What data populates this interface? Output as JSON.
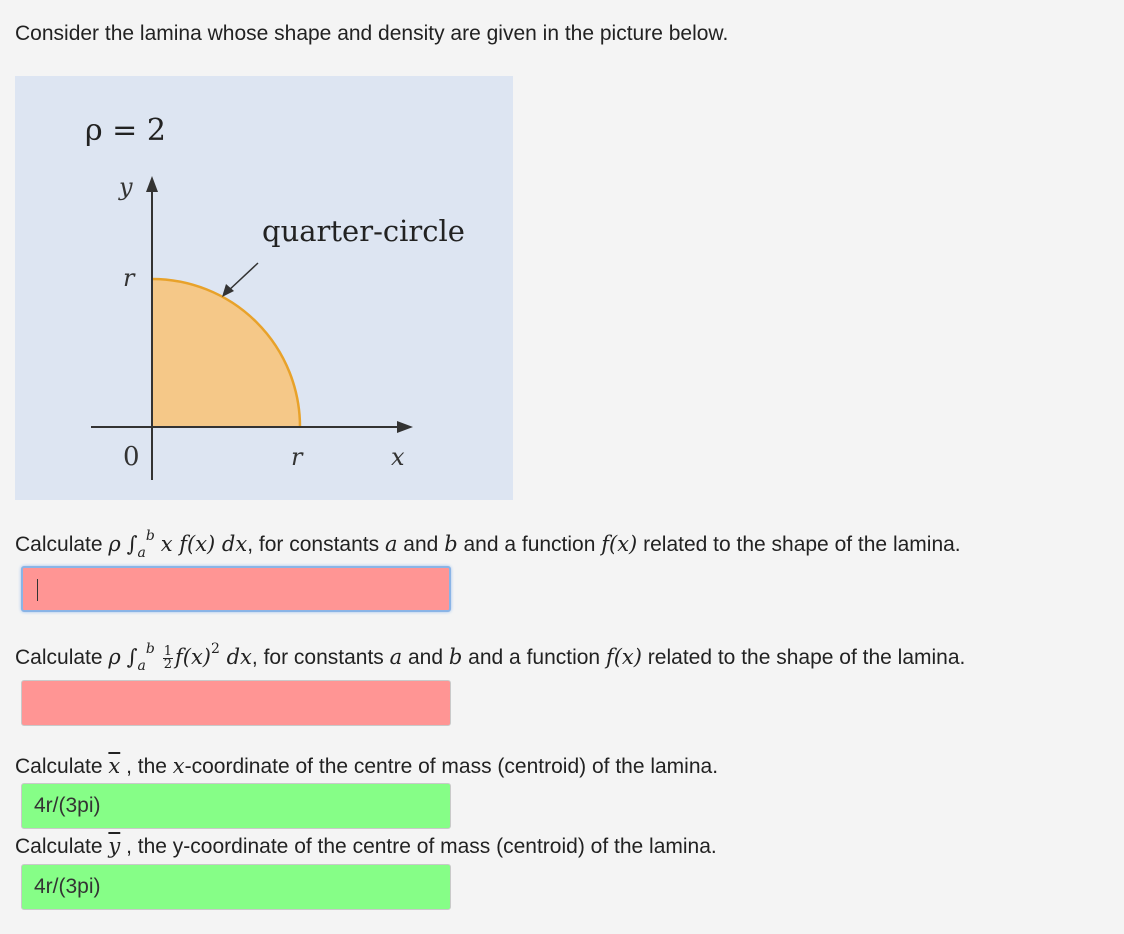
{
  "intro": "Consider the lamina whose shape and density are given in the picture below.",
  "figure": {
    "density_label": "ρ = 2",
    "y_axis": "y",
    "x_axis": "x",
    "r_vertical": "r",
    "r_horizontal": "r",
    "origin": "0",
    "shape_label": "quarter-circle",
    "colors": {
      "background": "#dde5f2",
      "fill": "#f5c888",
      "edge": "#e8a22a"
    }
  },
  "q1": {
    "prefix": "Calculate ",
    "rho": "ρ",
    "integral": "∫",
    "lower": "a",
    "upper": "b",
    "integrand": "x f(x) dx",
    "mid": ", for constants ",
    "a": "a",
    "and": " and ",
    "b": "b",
    "func_text": " and a function ",
    "fx": "f(x)",
    "suffix": " related to the shape of the lamina.",
    "value": "",
    "status": "incorrect"
  },
  "q2": {
    "prefix": "Calculate ",
    "rho": "ρ",
    "integral": "∫",
    "lower": "a",
    "upper": "b",
    "frac_num": "1",
    "frac_den": "2",
    "integrand": "f(x)",
    "power": "2",
    "dx": " dx",
    "mid": ", for constants ",
    "a": "a",
    "and": " and ",
    "b": "b",
    "func_text": " and a function ",
    "fx": "f(x)",
    "suffix": " related to the shape of the lamina.",
    "value": "",
    "status": "incorrect"
  },
  "q3": {
    "prefix": "Calculate ",
    "var": "x",
    "middle": " , the ",
    "coord": "x",
    "suffix": "-coordinate of the centre of mass (centroid) of the lamina.",
    "value": "4r/(3pi)",
    "status": "correct"
  },
  "q4": {
    "prefix": "Calculate ",
    "var": "y",
    "suffix": " , the y-coordinate of the centre of mass (centroid) of the lamina.",
    "value": "4r/(3pi)",
    "status": "correct"
  }
}
